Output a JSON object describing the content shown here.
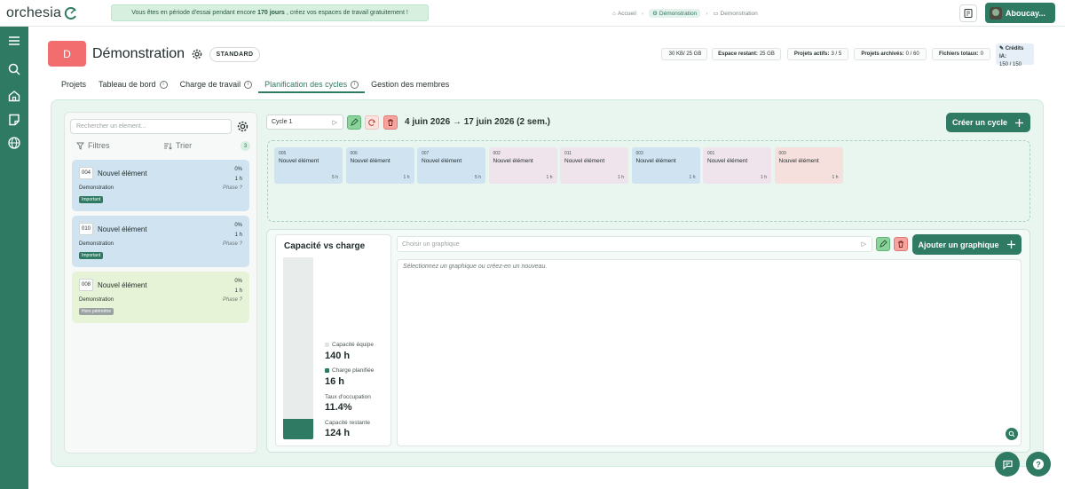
{
  "app": {
    "logo_text": "orchesia",
    "trial_prefix": "Vous êtes en période d'essai pendant encore",
    "trial_days": "170 jours",
    "trial_suffix": ", créez vos espaces de travail gratuitement !",
    "breadcrumb": [
      "Accueil",
      "Démonstration",
      "Demonstration"
    ],
    "user_name": "Aboucay..."
  },
  "colors": {
    "accent": "#2f7a62",
    "badge": "#f26d6d",
    "important": "#2f7a62",
    "out_of_scope": "#9aa3a1"
  },
  "project": {
    "initial": "D",
    "title": "Démonstration",
    "plan": "STANDARD",
    "stats": [
      {
        "label": "",
        "value": "30 KB/ 25 GB"
      },
      {
        "label": "Espace restant:",
        "value": "25 GB"
      },
      {
        "label": "Projets actifs:",
        "value": "3 / 5"
      },
      {
        "label": "Projets archivés:",
        "value": "0 / 60"
      },
      {
        "label": "Fichiers totaux:",
        "value": "0"
      }
    ],
    "credits_label": "Crédits IA:",
    "credits_value": "150 / 150"
  },
  "tabs": [
    {
      "label": "Projets",
      "info": false
    },
    {
      "label": "Tableau de bord",
      "info": true
    },
    {
      "label": "Charge de travail",
      "info": true
    },
    {
      "label": "Planification des cycles",
      "info": true,
      "active": true
    },
    {
      "label": "Gestion des membres",
      "info": false
    }
  ],
  "backlog": {
    "search_placeholder": "Rechercher un element...",
    "filters_label": "Filtres",
    "sort_label": "Trier",
    "count": "3",
    "cards": [
      {
        "id": "004",
        "title": "Nouvel élément",
        "progress": "0%",
        "hours": "1 h",
        "project": "Demonstration",
        "phase": "Phase ?",
        "tag": "Important",
        "color": "#cfe3f1",
        "tag_color": "#2f7a62"
      },
      {
        "id": "010",
        "title": "Nouvel élément",
        "progress": "0%",
        "hours": "1 h",
        "project": "Demonstration",
        "phase": "Phase ?",
        "tag": "Important",
        "color": "#cfe3f1",
        "tag_color": "#2f7a62"
      },
      {
        "id": "008",
        "title": "Nouvel élément",
        "progress": "0%",
        "hours": "1 h",
        "project": "Demonstration",
        "phase": "Phase ?",
        "tag": "Hors périmètre",
        "color": "#e6f3d6",
        "tag_color": "#9aa3a1"
      }
    ]
  },
  "cycle": {
    "selected": "Cycle 1",
    "dates": "4 juin 2026 → 17 juin 2026 (2 sem.)",
    "create_label": "Créer un cycle",
    "items": [
      {
        "id": "005",
        "title": "Nouvel élément",
        "hours": "5 h",
        "color": "#cfe3f1"
      },
      {
        "id": "006",
        "title": "Nouvel élément",
        "hours": "1 h",
        "color": "#cfe3f1"
      },
      {
        "id": "007",
        "title": "Nouvel élément",
        "hours": "5 h",
        "color": "#cfe3f1"
      },
      {
        "id": "002",
        "title": "Nouvel élément",
        "hours": "1 h",
        "color": "#efe3ec"
      },
      {
        "id": "011",
        "title": "Nouvel élément",
        "hours": "1 h",
        "color": "#efe3ec"
      },
      {
        "id": "003",
        "title": "Nouvel élément",
        "hours": "1 h",
        "color": "#cfe3f1"
      },
      {
        "id": "001",
        "title": "Nouvel élément",
        "hours": "1 h",
        "color": "#efe3ec"
      },
      {
        "id": "009",
        "title": "Nouvel élément",
        "hours": "1 h",
        "color": "#f5e0dd"
      }
    ]
  },
  "capacity": {
    "title": "Capacité vs charge",
    "team_label": "Capacité équipe",
    "team_value": "140 h",
    "planned_label": "Charge planifiée",
    "planned_value": "16 h",
    "occupancy_label": "Taux d'occupation",
    "occupancy_value": "11.4%",
    "occupancy_fraction": 0.114,
    "remaining_label": "Capacité restante",
    "remaining_value": "124 h"
  },
  "graph": {
    "select_placeholder": "Choisir un graphique",
    "add_label": "Ajouter un graphique",
    "empty_text": "Sélectionnez un graphique ou créez-en un nouveau."
  }
}
